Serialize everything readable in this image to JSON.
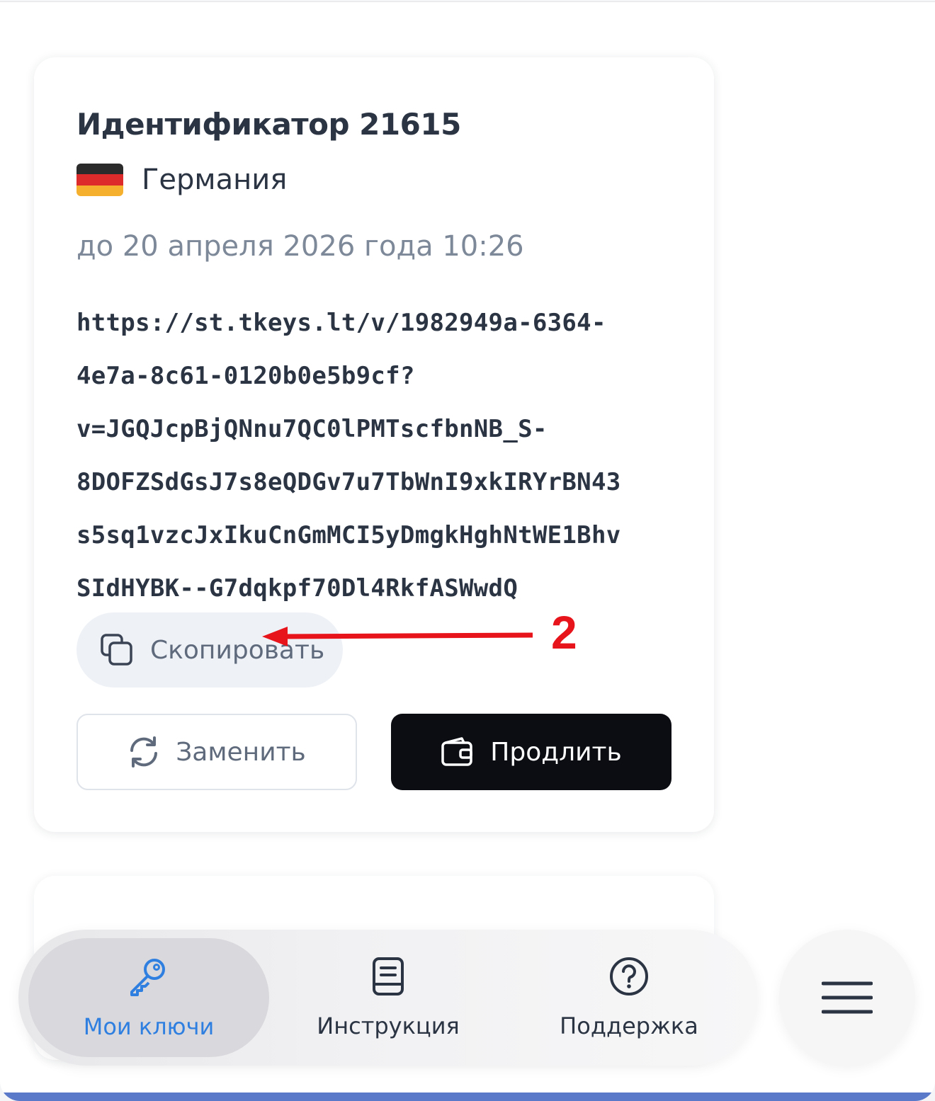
{
  "key_card": {
    "title": "Идентификатор 21615",
    "country": "Германия",
    "flag_colors": [
      "#2b2b2b",
      "#dd2b2b",
      "#f5b02e"
    ],
    "expiry": "до 20 апреля 2026 года 10:26",
    "key_lines": [
      "https://st.tkeys.lt/v/1982949a-6364-",
      "4e7a-8c61-0120b0e5b9cf?",
      "v=JGQJcpBjQNnu7QC0lPMTscfbnNB_S-",
      "8DOFZSdGsJ7s8eQDGv7u7TbWnI9xkIRYrBN43",
      "s5sq1vzcJxIkuCnGmMCI5yDmgkHghNtWE1Bhv",
      "SIdHYBK--G7dqkpf70Dl4RkfASWwdQ"
    ],
    "copy_label": "Скопировать",
    "copy_icon": "copy-icon",
    "replace_label": "Заменить",
    "replace_icon": "refresh-icon",
    "extend_label": "Продлить",
    "extend_icon": "wallet-icon"
  },
  "annotation": {
    "number": "2",
    "color": "#e8141b"
  },
  "tabbar": {
    "tabs": [
      {
        "label": "Мои ключи",
        "icon": "key-icon",
        "active": true
      },
      {
        "label": "Инструкция",
        "icon": "book-icon",
        "active": false
      },
      {
        "label": "Поддержка",
        "icon": "help-icon",
        "active": false
      }
    ],
    "menu_icon": "hamburger-menu-icon",
    "active_color": "#2f7fe0"
  }
}
